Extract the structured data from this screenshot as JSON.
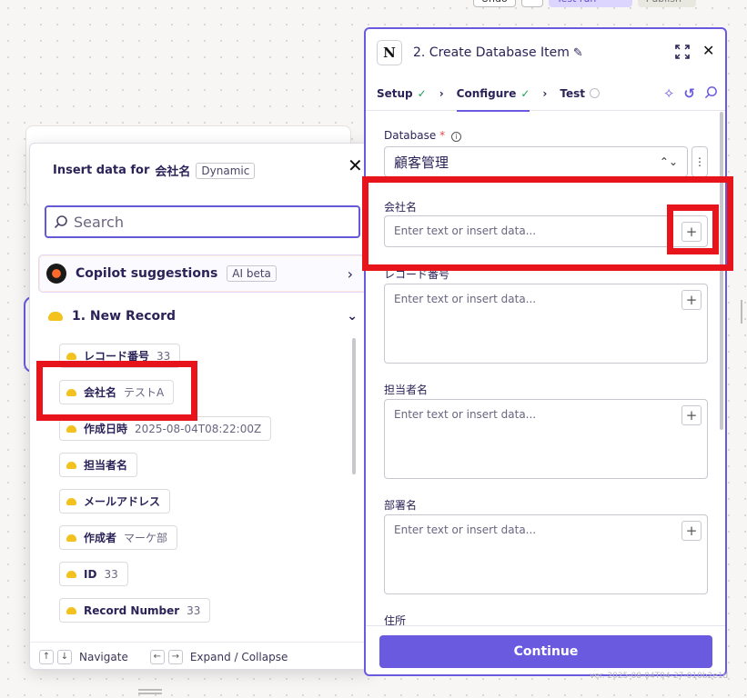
{
  "toolbar": {
    "undo_label": "Undo",
    "test_run_label": "Test run",
    "publish_label": "Publish"
  },
  "popover": {
    "title_prefix": "Insert data for",
    "field_name": "会社名",
    "badge": "Dynamic",
    "search_placeholder": "Search",
    "copilot_label": "Copilot suggestions",
    "copilot_badge": "AI beta",
    "group_label": "1.  New Record",
    "items": [
      {
        "label": "レコード番号",
        "value": "33"
      },
      {
        "label": "会社名",
        "value": "テストA"
      },
      {
        "label": "作成日時",
        "value": "2025-08-04T08:22:00Z"
      },
      {
        "label": "担当者名",
        "value": ""
      },
      {
        "label": "メールアドレス",
        "value": ""
      },
      {
        "label": "作成者",
        "value": "マーケ部"
      },
      {
        "label": "ID",
        "value": "33"
      },
      {
        "label": "Record Number",
        "value": "33"
      }
    ],
    "footer": {
      "navigate_label": "Navigate",
      "expand_label": "Expand / Collapse"
    }
  },
  "panel": {
    "title": "2. Create Database Item",
    "tabs": [
      {
        "label": "Setup",
        "status": "done"
      },
      {
        "label": "Configure",
        "status": "done",
        "active": true
      },
      {
        "label": "Test",
        "status": "pending"
      }
    ],
    "database_label": "Database",
    "database_required": "*",
    "database_value": "顧客管理",
    "fields": [
      {
        "label": "会社名",
        "placeholder": "Enter text or insert data..."
      },
      {
        "label": "レコード番号",
        "placeholder": "Enter text or insert data..."
      },
      {
        "label": "担当者名",
        "placeholder": "Enter text or insert data..."
      },
      {
        "label": "部署名",
        "placeholder": "Enter text or insert data..."
      },
      {
        "label": "住所",
        "placeholder": ""
      }
    ],
    "continue_label": "Continue"
  },
  "version_text": "ver. 2025-08-04T04-27-010b2e1d",
  "colors": {
    "accent": "#6a5ae0",
    "highlight": "#e8141b",
    "success": "#1e9e5a"
  },
  "icons": [
    "notion-icon",
    "pencil-icon",
    "expand-icon",
    "close-icon",
    "sparkle-icon",
    "undo-icon",
    "search-icon",
    "chevron-right-icon",
    "chevron-down-icon",
    "plus-icon",
    "info-icon",
    "copilot-icon"
  ]
}
